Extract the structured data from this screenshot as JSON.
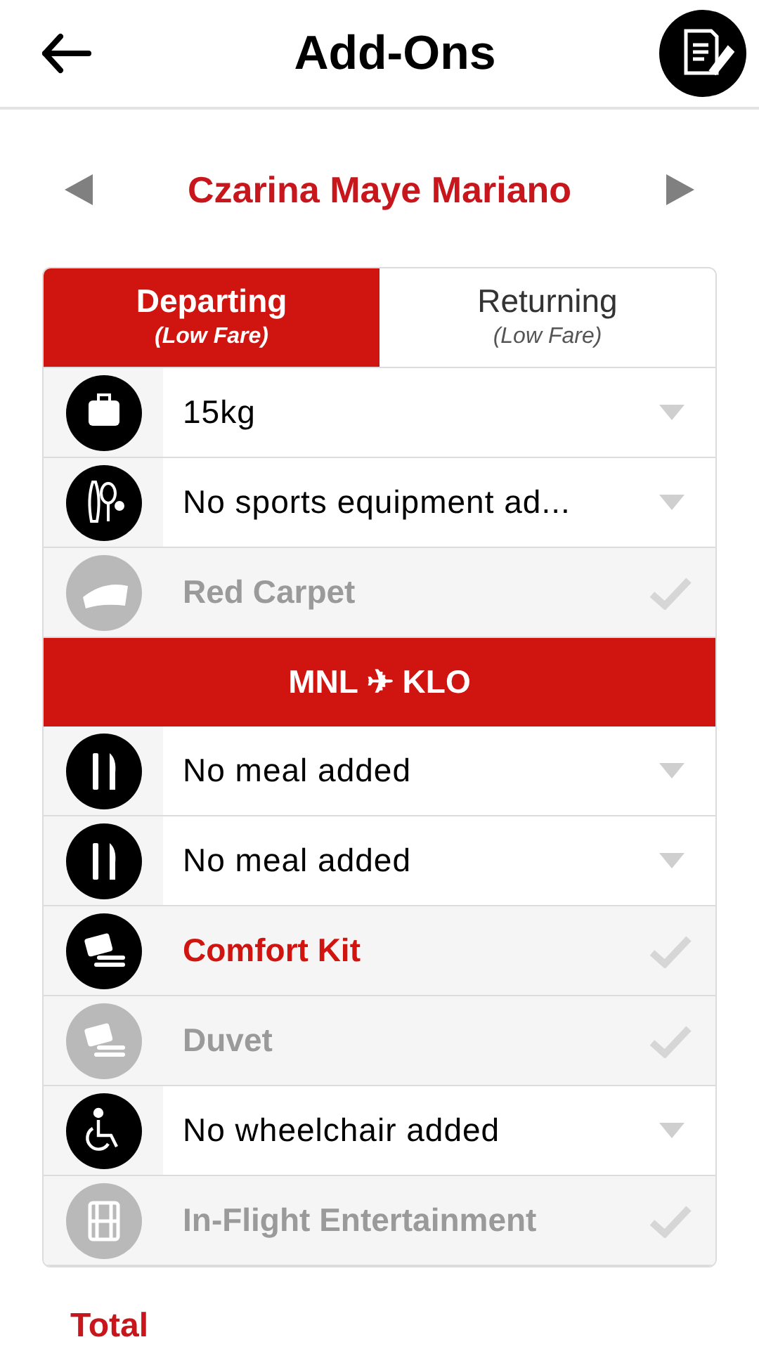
{
  "header": {
    "title": "Add-Ons"
  },
  "passenger": {
    "name": "Czarina Maye Mariano"
  },
  "tabs": [
    {
      "label": "Departing",
      "sub": "(Low Fare)",
      "selected": true
    },
    {
      "label": "Returning",
      "sub": "(Low Fare)",
      "selected": false
    }
  ],
  "rows_before": [
    {
      "kind": "dropdown",
      "value": "15kg"
    },
    {
      "kind": "dropdown",
      "value": "No sports equipment ad..."
    },
    {
      "kind": "toggle",
      "label": "Red Carpet",
      "disabled": true
    }
  ],
  "route": "MNL ✈ KLO",
  "rows_after": [
    {
      "kind": "dropdown",
      "value": "No meal added"
    },
    {
      "kind": "dropdown",
      "value": "No meal added"
    },
    {
      "kind": "toggle",
      "label": "Comfort Kit",
      "disabled": false
    },
    {
      "kind": "toggle",
      "label": "Duvet",
      "disabled": true
    },
    {
      "kind": "dropdown",
      "value": "No wheelchair added"
    },
    {
      "kind": "toggle",
      "label": "In-Flight Entertainment",
      "disabled": true
    }
  ],
  "total_label": "Total"
}
